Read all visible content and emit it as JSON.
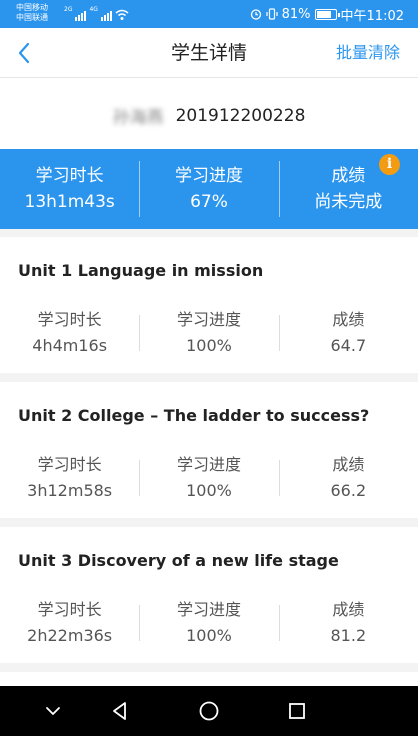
{
  "status_bar": {
    "carrier_1": "中国移动",
    "carrier_2": "中国联通",
    "net_1": "2G",
    "net_2": "4G",
    "battery_percent": "81%",
    "battery_level": 0.81,
    "time": "中午11:02"
  },
  "nav": {
    "title": "学生详情",
    "clear_label": "批量清除"
  },
  "student": {
    "name": "孙海燕",
    "id": "201912200228"
  },
  "summary": {
    "duration_label": "学习时长",
    "duration_value": "13h1m43s",
    "progress_label": "学习进度",
    "progress_value": "67%",
    "score_label": "成绩",
    "score_value": "尚未完成",
    "info_icon": "i"
  },
  "units": [
    {
      "title": "Unit 1  Language in mission",
      "duration_label": "学习时长",
      "duration_value": "4h4m16s",
      "progress_label": "学习进度",
      "progress_value": "100%",
      "score_label": "成绩",
      "score_value": "64.7"
    },
    {
      "title": "Unit 2  College – The ladder to success?",
      "duration_label": "学习时长",
      "duration_value": "3h12m58s",
      "progress_label": "学习进度",
      "progress_value": "100%",
      "score_label": "成绩",
      "score_value": "66.2"
    },
    {
      "title": "Unit 3  Discovery of a new life stage",
      "duration_label": "学习时长",
      "duration_value": "2h22m36s",
      "progress_label": "学习进度",
      "progress_value": "100%",
      "score_label": "成绩",
      "score_value": "81.2"
    }
  ],
  "icons": {
    "back": "chevron-left-icon",
    "info": "info-icon",
    "nav_down": "chevron-down-icon",
    "nav_back": "triangle-back-icon",
    "nav_home": "circle-home-icon",
    "nav_recent": "square-recent-icon"
  },
  "colors": {
    "accent": "#2b95ee",
    "warning": "#f39c12"
  }
}
